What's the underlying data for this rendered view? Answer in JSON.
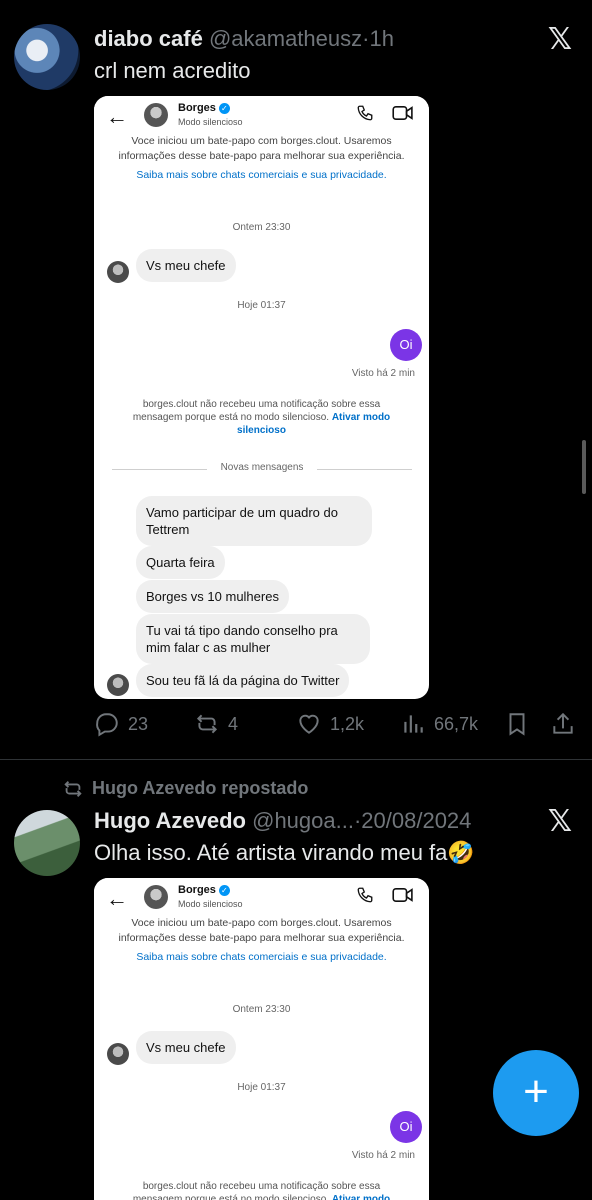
{
  "colors": {
    "background": "#000000",
    "accent": "#1d9bf0",
    "muted": "#71767b",
    "sent_bubble": "#7b35e6",
    "link": "#0070c9"
  },
  "tweet1": {
    "name": "diabo café",
    "handle": "@akamatheusz",
    "dot": "·",
    "time": "1h",
    "text": "crl nem acredito",
    "icons": {
      "logo": "x-logo-icon"
    },
    "stats": {
      "replies": "23",
      "reposts": "4",
      "likes": "1,2k",
      "views": "66,7k"
    }
  },
  "dm": {
    "contact_name": "Borges",
    "status": "Modo silencioso",
    "info": "Voce iniciou um bate-papo com borges.clout. Usaremos informações desse bate-papo para melhorar sua experiência.",
    "info_link": "Saiba mais sobre chats comerciais e sua privacidade.",
    "stamp1": "Ontem 23:30",
    "msg1": "Vs meu chefe",
    "stamp2": "Hoje 01:37",
    "sent": "Oi",
    "seen": "Visto há 2 min",
    "notice": "borges.clout não recebeu uma notificação sobre essa mensagem porque está no modo silencioso.",
    "notice_action": "Ativar modo silencioso",
    "separator": "Novas mensagens",
    "messages": [
      "Vamo participar de um quadro do Tettrem",
      "Quarta feira",
      "Borges vs 10 mulheres",
      "Tu vai tá tipo dando conselho pra mim falar c as mulher",
      "Sou teu fã lá da página do Twitter"
    ]
  },
  "repost_label": "Hugo Azevedo repostado",
  "tweet2": {
    "name": "Hugo Azevedo",
    "handle": "@hugoa...",
    "dot": "·",
    "time": "20/08/2024",
    "text": "Olha isso. Até artista virando meu fa🤣"
  },
  "fab_label": "+"
}
